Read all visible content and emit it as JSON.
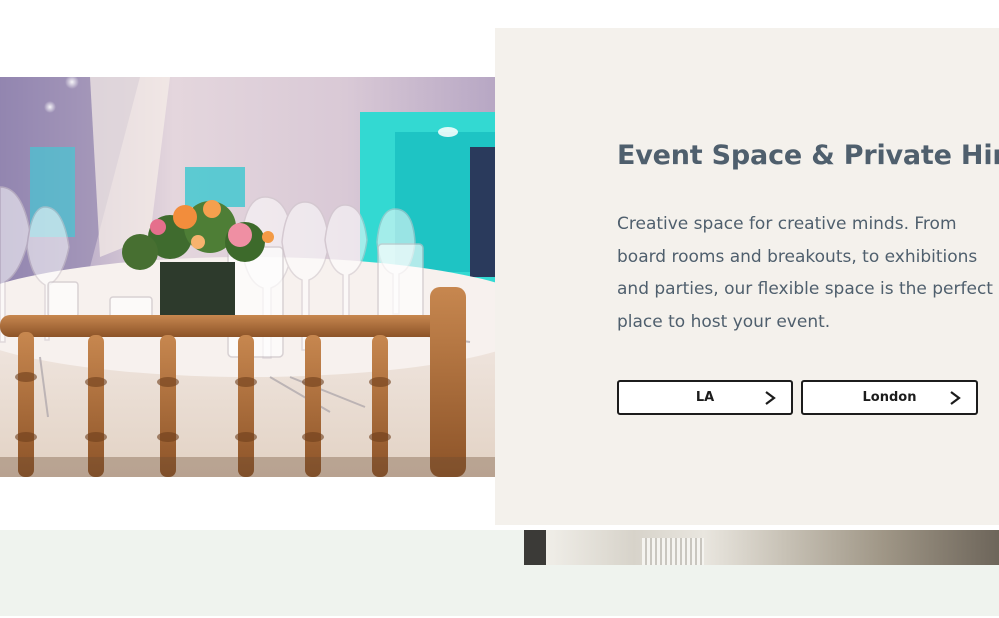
{
  "event_space": {
    "title": "Event Space & Private Hire",
    "description": "Creative space for creative minds. From board rooms and breakouts, to exhibitions and parties, our flexible space is the perfect place to host your event.",
    "buttons": [
      {
        "label": "LA",
        "icon": "chevron-right-icon"
      },
      {
        "label": "London",
        "icon": "chevron-right-icon"
      }
    ]
  },
  "colors": {
    "card_background": "#f4f1ec",
    "heading_text": "#4f5f6d",
    "button_border": "#1c1c1c",
    "band_background": "#eff3ee"
  }
}
